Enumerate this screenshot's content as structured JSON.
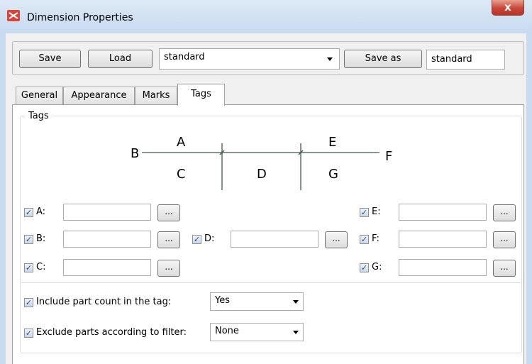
{
  "window": {
    "title": "Dimension Properties",
    "close_label": "x"
  },
  "toolbar": {
    "save_label": "Save",
    "load_label": "Load",
    "preset_value": "standard",
    "save_as_label": "Save as",
    "save_as_name": "standard"
  },
  "tabs": [
    {
      "label": "General",
      "active": false
    },
    {
      "label": "Appearance",
      "active": false
    },
    {
      "label": "Marks",
      "active": false
    },
    {
      "label": "Tags",
      "active": true
    }
  ],
  "tags_group": {
    "title": "Tags",
    "diagram_labels": {
      "A": "A",
      "B": "B",
      "C": "C",
      "D": "D",
      "E": "E",
      "F": "F",
      "G": "G"
    },
    "fields": [
      {
        "label": "A:",
        "checked": true,
        "value": "",
        "browse_label": "..."
      },
      {
        "label": "B:",
        "checked": true,
        "value": "",
        "browse_label": "..."
      },
      {
        "label": "C:",
        "checked": true,
        "value": "",
        "browse_label": "..."
      },
      {
        "label": "D:",
        "checked": true,
        "value": "",
        "browse_label": "..."
      },
      {
        "label": "E:",
        "checked": true,
        "value": "",
        "browse_label": "..."
      },
      {
        "label": "F:",
        "checked": true,
        "value": "",
        "browse_label": "..."
      },
      {
        "label": "G:",
        "checked": true,
        "value": "",
        "browse_label": "..."
      }
    ],
    "include_part_count": {
      "label": "Include part count in the tag:",
      "checked": true,
      "value": "Yes"
    },
    "exclude_parts": {
      "label": "Exclude parts according to filter:",
      "checked": true,
      "value": "None"
    }
  },
  "colors": {
    "title_bar": "#c7daf0",
    "close_button": "#c7483a",
    "checkbox_mark": "#2c4b7a"
  },
  "icons": {
    "app": "dimension-properties-app-icon",
    "close": "close-icon",
    "dropdown": "chevron-down-icon",
    "check": "checkmark-icon"
  }
}
